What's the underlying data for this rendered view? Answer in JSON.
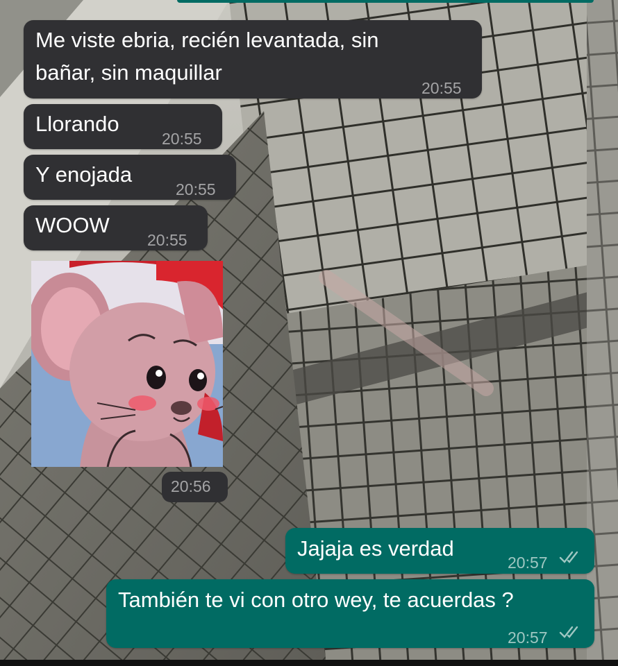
{
  "chat": {
    "colors": {
      "incoming_bubble": "#303033",
      "outgoing_bubble": "#016b63",
      "text": "#ffffff",
      "timestamp": "#a4a4a6",
      "read_ticks": "#9fc7c2"
    },
    "messages": [
      {
        "direction": "incoming",
        "text_line1": "Me viste ebria, recién levantada, sin",
        "text_line2": "bañar, sin maquillar",
        "time": "20:55"
      },
      {
        "direction": "incoming",
        "text": "Llorando",
        "time": "20:55"
      },
      {
        "direction": "incoming",
        "text": "Y enojada",
        "time": "20:55"
      },
      {
        "direction": "incoming",
        "text": "WOOW",
        "time": "20:55"
      },
      {
        "direction": "incoming",
        "sticker": "jerry-mouse-sad-sticker",
        "time": "20:56"
      },
      {
        "direction": "outgoing",
        "text": "Jajaja es verdad",
        "time": "20:57",
        "status": "read-double-check-icon"
      },
      {
        "direction": "outgoing",
        "text": "También te vi con otro wey, te acuerdas ?",
        "time": "20:57",
        "status": "read-double-check-icon"
      }
    ]
  }
}
